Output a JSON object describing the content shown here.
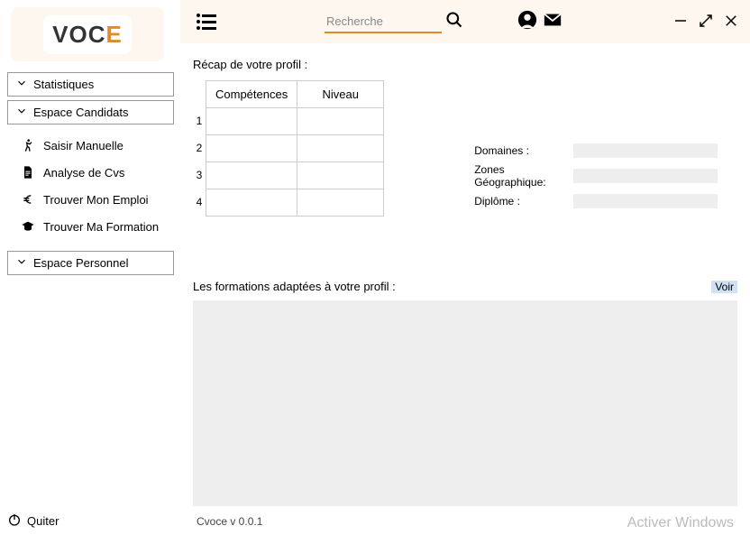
{
  "app": {
    "name": "Cvoce",
    "version": "Cvoce v 0.0.1"
  },
  "topbar": {
    "search_placeholder": "Recherche"
  },
  "sidebar": {
    "stats": "Statistiques",
    "candidats": "Espace Candidats",
    "personnel": "Espace Personnel",
    "items": [
      {
        "label": "Saisir Manuelle"
      },
      {
        "label": "Analyse de Cvs"
      },
      {
        "label": "Trouver Mon Emploi"
      },
      {
        "label": "Trouver Ma Formation"
      }
    ],
    "quit": "Quiter"
  },
  "main": {
    "recap_title": "Récap de votre profil :",
    "table": {
      "col1": "Compétences",
      "col2": "Niveau",
      "rows": [
        "1",
        "2",
        "3",
        "4"
      ]
    },
    "fields": {
      "domaines_label": "Domaines :",
      "domaines_val": "",
      "zones_label": "Zones Géographique:",
      "zones_val": "",
      "diplome_label": "Diplôme :",
      "diplome_val": ""
    },
    "formations_title": "Les formations adaptées à votre profil :",
    "voir": "Voir"
  },
  "footer": {
    "activate": "Activer Windows"
  }
}
